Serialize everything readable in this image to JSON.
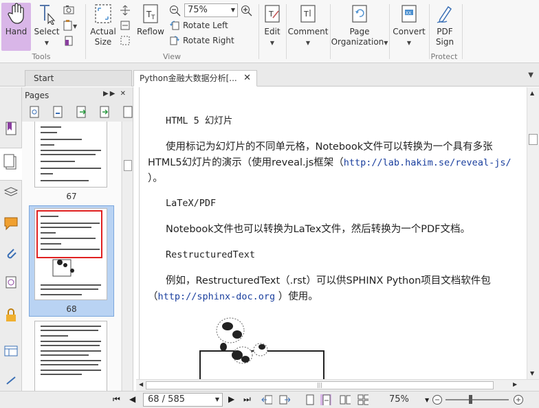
{
  "ribbon": {
    "tools": {
      "hand_label": "Hand",
      "select_label": "Select",
      "group_label": "Tools"
    },
    "view": {
      "actual_size_label": "Actual\nSize",
      "actual_size_line1": "Actual",
      "actual_size_line2": "Size",
      "reflow_label": "Reflow",
      "zoom_value": "75%",
      "rotate_left_label": "Rotate Left",
      "rotate_right_label": "Rotate Right",
      "group_label": "View"
    },
    "edit_label": "Edit",
    "comment_label": "Comment",
    "page_org_line1": "Page",
    "page_org_line2": "Organization",
    "convert_label": "Convert",
    "protect": {
      "pdf_sign_line1": "PDF",
      "pdf_sign_line2": "Sign",
      "group_label": "Protect"
    }
  },
  "tabs": [
    {
      "label": "Start"
    },
    {
      "label": "Python金融大数据分析[..."
    }
  ],
  "pages_panel": {
    "title": "Pages",
    "thumbnails": [
      {
        "page": "67"
      },
      {
        "page": "68"
      }
    ]
  },
  "document": {
    "heading1": "HTML 5 幻灯片",
    "para1_text": "使用标记为幻灯片的不同单元格，Notebook文件可以转换为一个具有多张HTML5幻灯片的演示（使用reveal.js框架（",
    "para1_line1": "使用标记为幻灯片的不同单元格，Notebook文件可以转换为一个具有多张",
    "para1_line2a": "HTML5幻灯片的演示（使用reveal.js框架（",
    "para1_link": "http://lab.hakim.se/reveal-js/",
    "para1_line3": "）。",
    "heading2": "LaTeX/PDF",
    "para2": "Notebook文件也可以转换为LaTex文件，然后转换为一个PDF文档。",
    "heading3": "RestructuredText",
    "para3_line1": "例如，RestructuredText（.rst）可以供SPHINX Python项目文档软件包",
    "para3_line2a": "（",
    "para3_link": "http://sphinx-doc.org",
    "para3_line2b": " ）使用。"
  },
  "status": {
    "page_indicator": "68 / 585",
    "zoom": "75%"
  },
  "colors": {
    "accent_hand": "#d9b6e8",
    "link": "#1a3f9e",
    "thumb_selection": "#b9d3f3",
    "highlight_box": "#e02020"
  }
}
